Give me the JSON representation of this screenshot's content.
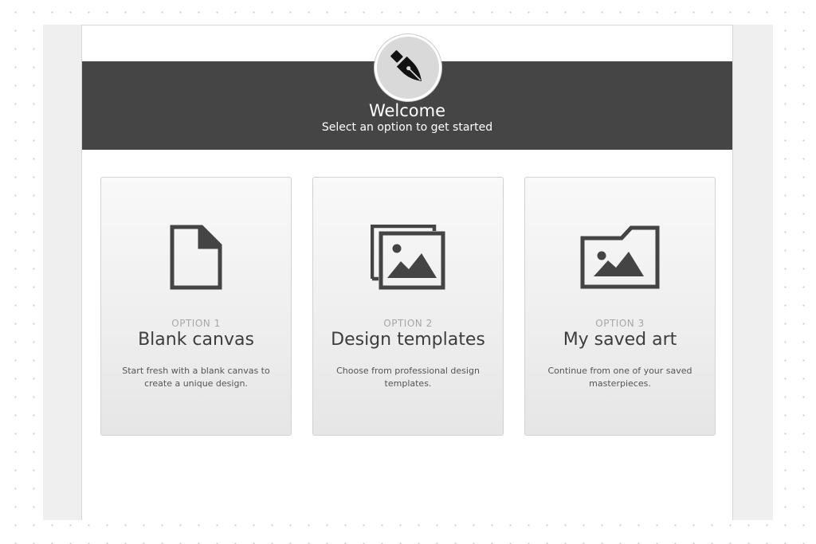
{
  "header": {
    "title": "Welcome",
    "subtitle": "Select an option to get started",
    "logo_icon": "pen-nib-icon"
  },
  "options": [
    {
      "number": "OPTION 1",
      "title": "Blank canvas",
      "description": "Start fresh with a blank canvas to create a unique design.",
      "icon": "blank-document-icon"
    },
    {
      "number": "OPTION 2",
      "title": "Design templates",
      "description": "Choose from professional design templates.",
      "icon": "image-stack-icon"
    },
    {
      "number": "OPTION 3",
      "title": "My saved art",
      "description": "Continue from one of your saved masterpieces.",
      "icon": "image-folder-icon"
    }
  ],
  "colors": {
    "header_band": "#454545",
    "icon": "#444444",
    "card_border": "#d2d2d2",
    "option_number": "#a7a7a7"
  }
}
